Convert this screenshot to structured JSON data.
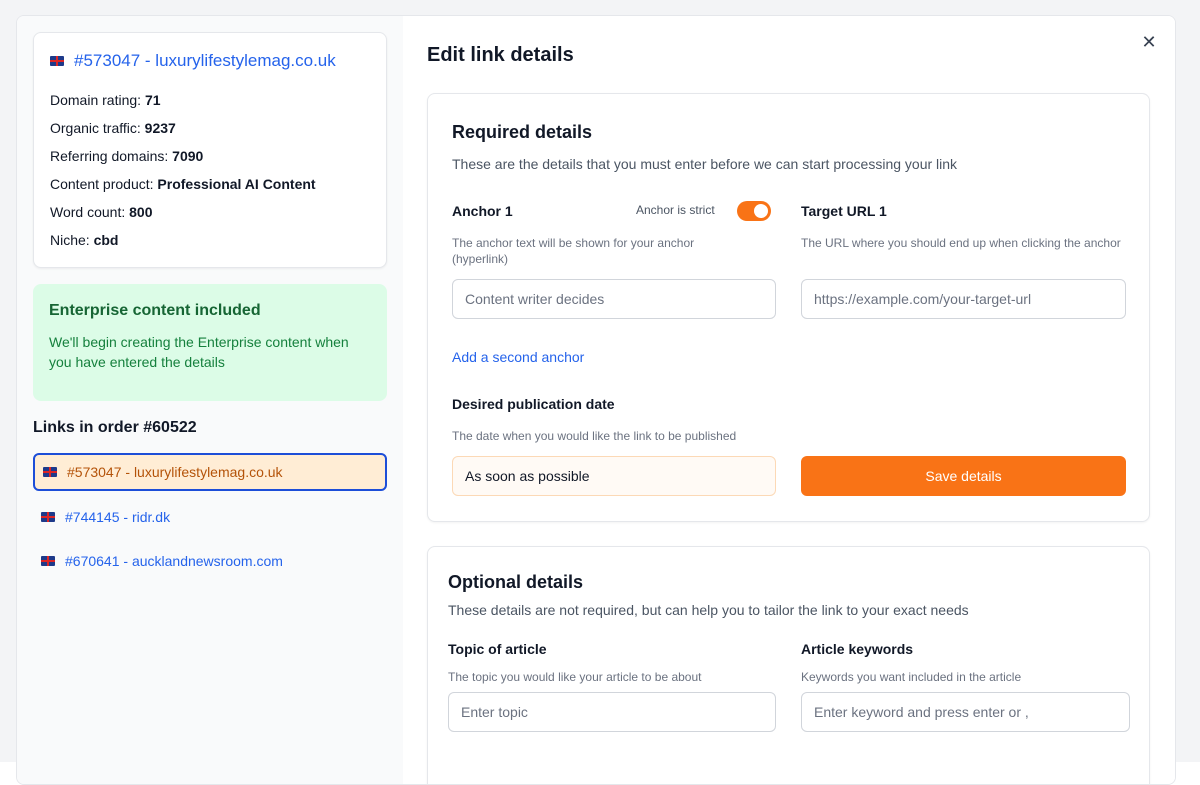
{
  "domain": {
    "title": "#573047 - luxurylifestylemag.co.uk",
    "stats": [
      {
        "label": "Domain rating:",
        "value": "71"
      },
      {
        "label": "Organic traffic:",
        "value": "9237"
      },
      {
        "label": "Referring domains:",
        "value": "7090"
      },
      {
        "label": "Content product:",
        "value": "Professional AI Content"
      },
      {
        "label": "Word count:",
        "value": "800"
      },
      {
        "label": "Niche:",
        "value": "cbd"
      }
    ]
  },
  "enterprise": {
    "title": "Enterprise content included",
    "description": "We'll begin creating the Enterprise content when you have entered the details"
  },
  "links": {
    "title": "Links in order #60522",
    "items": [
      {
        "label": "#573047 - luxurylifestylemag.co.uk",
        "active": true
      },
      {
        "label": "#744145 - ridr.dk",
        "active": false
      },
      {
        "label": "#670641 - aucklandnewsroom.com",
        "active": false
      }
    ]
  },
  "header": {
    "title": "Edit link details",
    "close_icon": "close-icon"
  },
  "required": {
    "title": "Required details",
    "description": "These are the details that you must enter before we can start processing your link",
    "anchor_label": "Anchor 1",
    "anchor_strict_label": "Anchor is strict",
    "anchor_strict_on": true,
    "anchor_help": "The anchor text will be shown for your anchor (hyperlink)",
    "anchor_placeholder": "Content writer decides",
    "target_label": "Target URL 1",
    "target_help": "The URL where you should end up when clicking the anchor",
    "target_placeholder": "https://example.com/your-target-url",
    "add_anchor": "Add a second anchor",
    "date_label": "Desired publication date",
    "date_help": "The date when you would like the link to be published",
    "date_value": "As soon as possible",
    "save_label": "Save details"
  },
  "optional": {
    "title": "Optional details",
    "description": "These details are not required, but can help you to tailor the link to your exact needs",
    "topic_label": "Topic of article",
    "topic_help": "The topic you would like your article to be about",
    "topic_placeholder": "Enter topic",
    "keywords_label": "Article keywords",
    "keywords_help": "Keywords you want included in the article",
    "keywords_placeholder": "Enter keyword and press enter or ,"
  },
  "colors": {
    "accent": "#f97316",
    "link": "#2563eb",
    "success_bg": "#dcfce7",
    "success_text": "#166534"
  }
}
